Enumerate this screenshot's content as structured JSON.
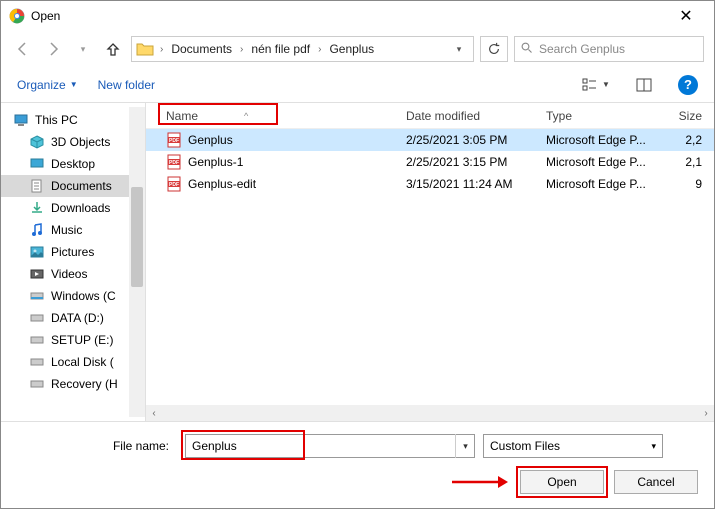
{
  "title": "Open",
  "breadcrumb": {
    "a": "Documents",
    "b": "nén file pdf",
    "c": "Genplus"
  },
  "search_placeholder": "Search Genplus",
  "toolbar": {
    "organize": "Organize",
    "newfolder": "New folder"
  },
  "tree": {
    "thispc": "This PC",
    "objects3d": "3D Objects",
    "desktop": "Desktop",
    "documents": "Documents",
    "downloads": "Downloads",
    "music": "Music",
    "pictures": "Pictures",
    "videos": "Videos",
    "winc": "Windows (C",
    "datad": "DATA (D:)",
    "setupe": "SETUP (E:)",
    "localdisk": "Local Disk (",
    "recovery": "Recovery (H"
  },
  "columns": {
    "name": "Name",
    "date": "Date modified",
    "type": "Type",
    "size": "Size"
  },
  "files": [
    {
      "name": "Genplus",
      "date": "2/25/2021 3:05 PM",
      "type": "Microsoft Edge P...",
      "size": "2,2"
    },
    {
      "name": "Genplus-1",
      "date": "2/25/2021 3:15 PM",
      "type": "Microsoft Edge P...",
      "size": "2,1"
    },
    {
      "name": "Genplus-edit",
      "date": "3/15/2021 11:24 AM",
      "type": "Microsoft Edge P...",
      "size": "9"
    }
  ],
  "footer": {
    "filename_label": "File name:",
    "filename_value": "Genplus",
    "filter": "Custom Files",
    "open": "Open",
    "cancel": "Cancel"
  }
}
